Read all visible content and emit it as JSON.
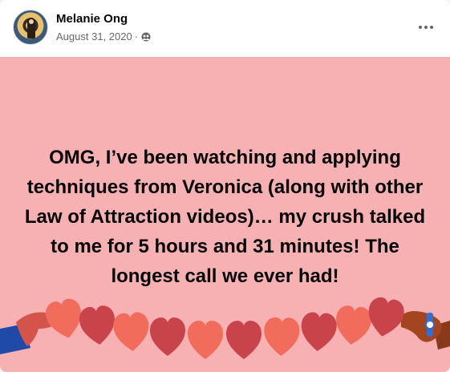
{
  "post": {
    "author": "Melanie Ong",
    "date": "August 31, 2020",
    "separator": "·",
    "audience_icon": "friends-icon",
    "more_icon": "more-options-icon",
    "text": "OMG, I’ve been watching and applying techniques from Veronica (along with other Law of Attraction videos)… my crush talked to me for 5 hours and 31 minutes! The longest call we ever had!",
    "background_color": "#f8b1b2",
    "decoration": "heart-garland-with-hands"
  }
}
